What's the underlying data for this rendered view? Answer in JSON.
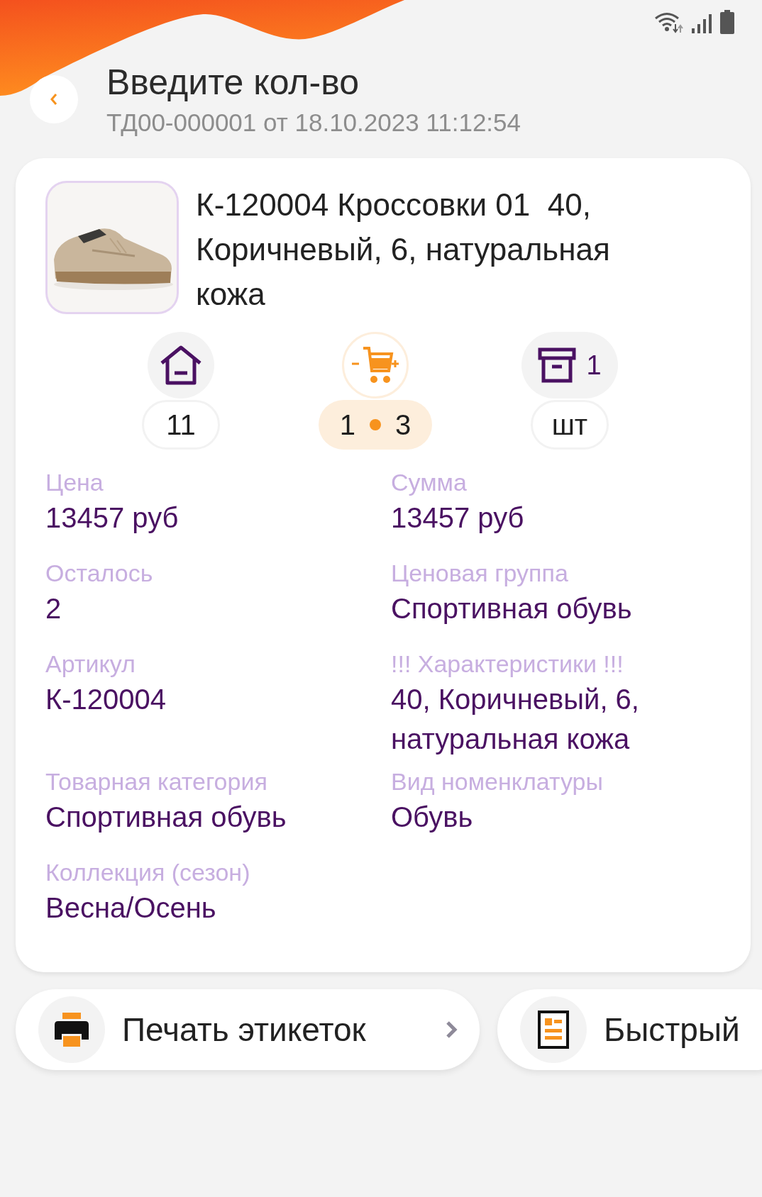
{
  "header": {
    "title": "Введите кол-во",
    "subtitle": "ТД00-000001 от 18.10.2023 11:12:54"
  },
  "product": {
    "name": "К-120004 Кроссовки 01  40, Коричневый, 6, натуральная кожа"
  },
  "counters": [
    {
      "kind": "warehouse",
      "value": "11",
      "selected": false
    },
    {
      "kind": "cart",
      "values": [
        "1",
        "3"
      ],
      "selected": true
    },
    {
      "kind": "package",
      "badge": "1",
      "value": "шт",
      "selected": false
    }
  ],
  "fields": [
    {
      "label": "Цена",
      "value": "13457 руб"
    },
    {
      "label": "Сумма",
      "value": "13457 руб"
    },
    {
      "label": "Осталось",
      "value": "2"
    },
    {
      "label": "Ценовая группа",
      "value": "Спортивная обувь"
    },
    {
      "label": "Артикул",
      "value": "К-120004"
    },
    {
      "label": "!!! Характеристики !!!",
      "value": "40, Коричневый, 6, натуральная кожа"
    },
    {
      "label": "Товарная категория",
      "value": "Спортивная обувь"
    },
    {
      "label": "Вид номенклатуры",
      "value": "Обувь"
    },
    {
      "label": "Коллекция (сезон)",
      "value": "Весна/Осень"
    }
  ],
  "actions": [
    {
      "kind": "print",
      "label": "Печать этикеток",
      "chevron": true
    },
    {
      "kind": "quick",
      "label": "Быстрый"
    }
  ]
}
